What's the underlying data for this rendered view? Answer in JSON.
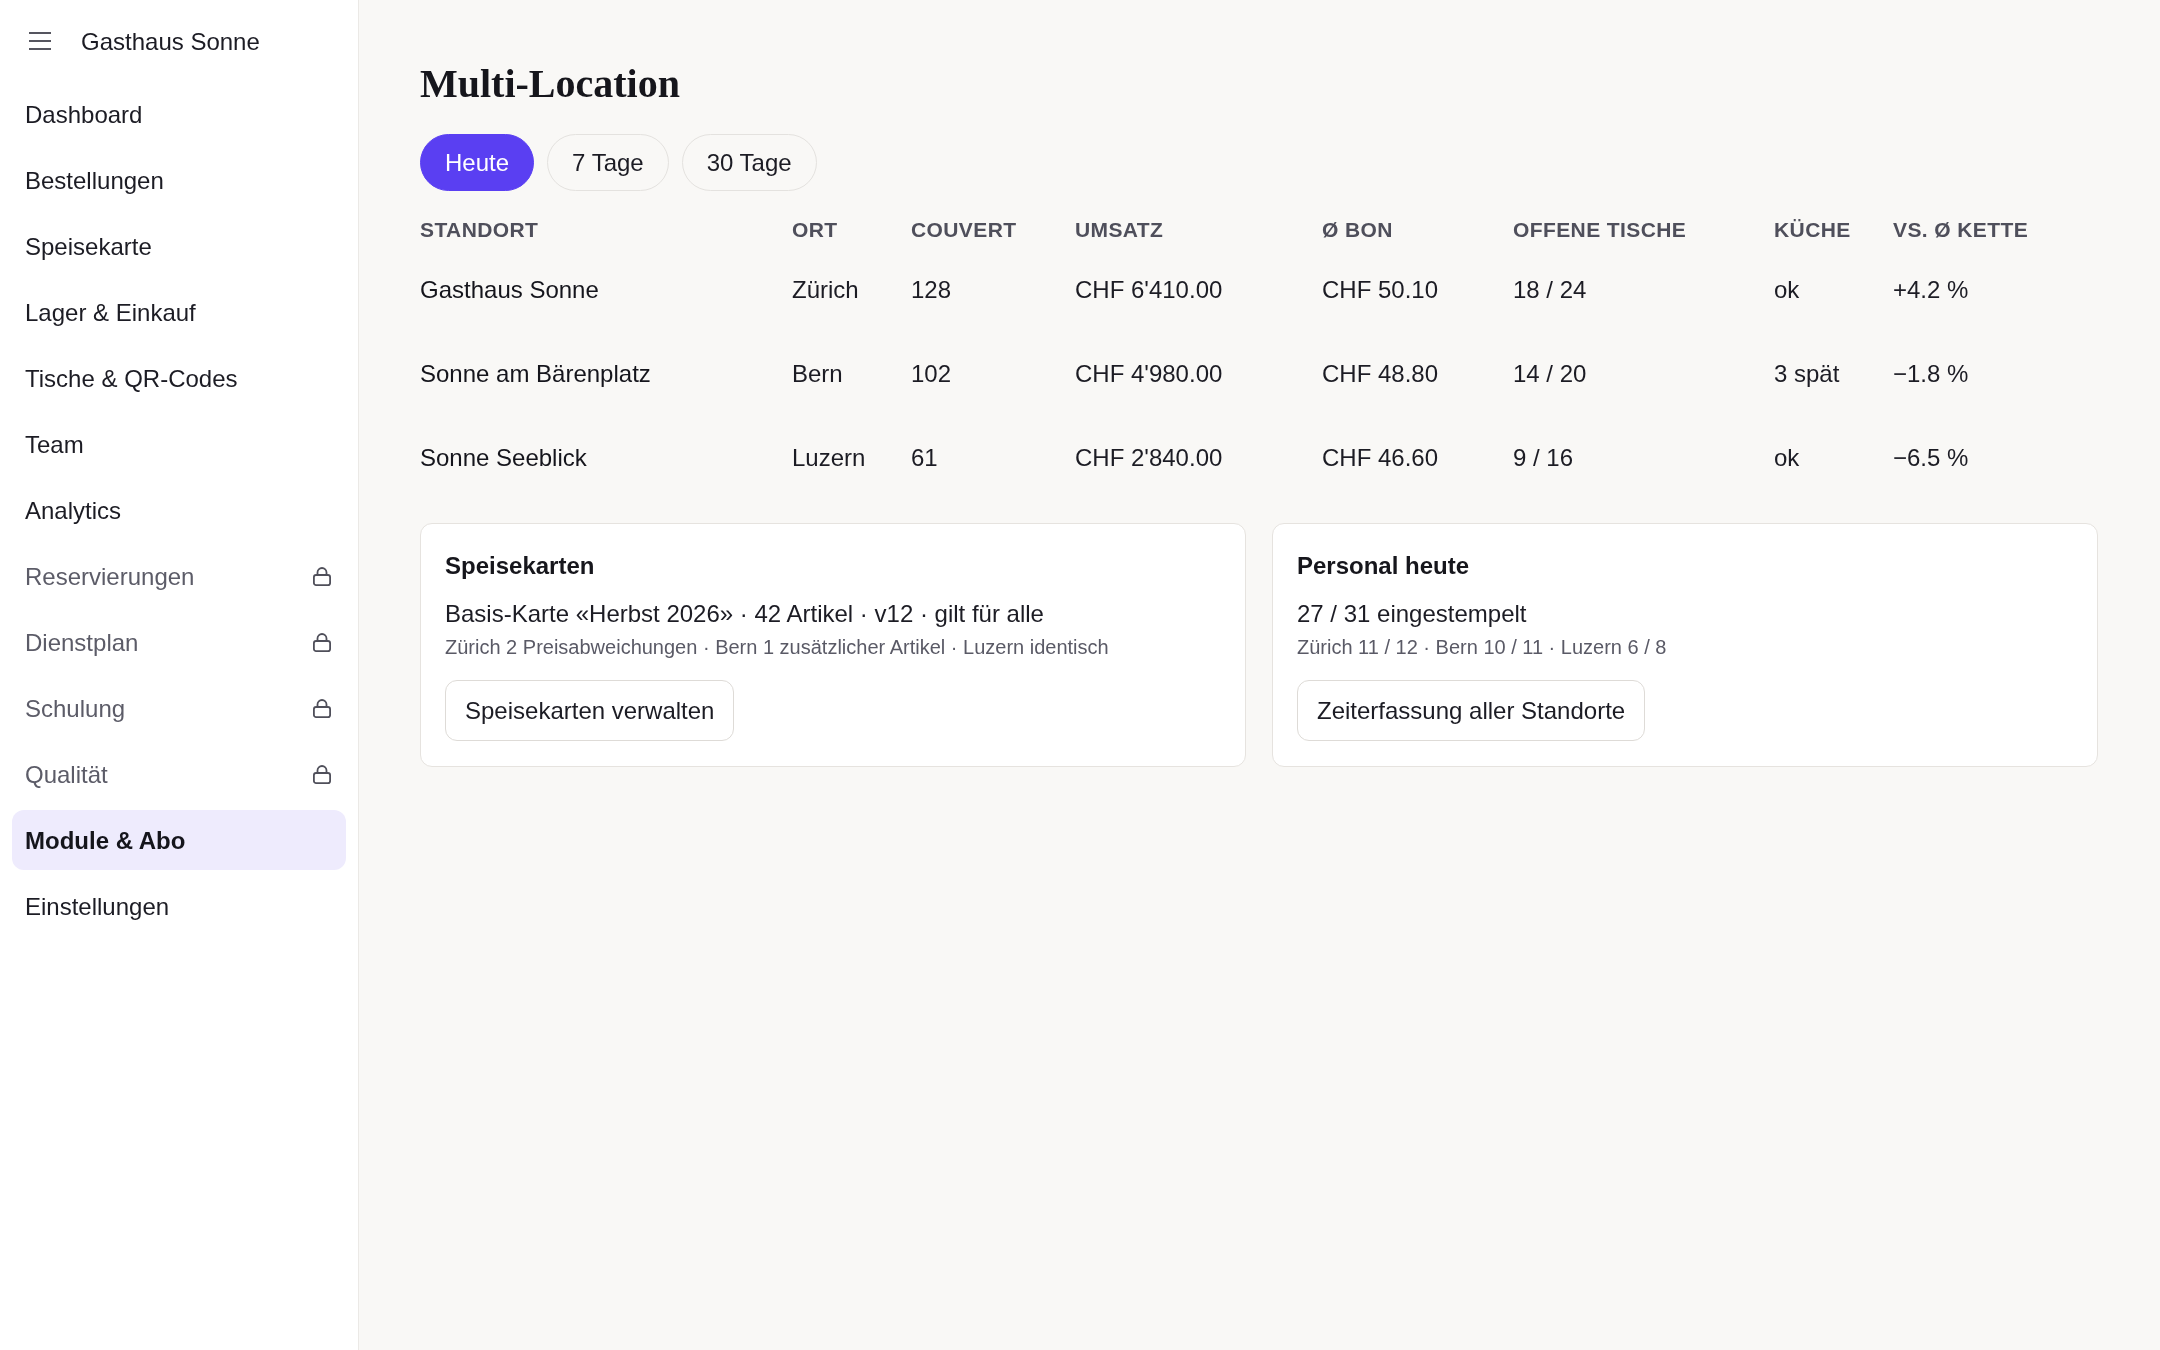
{
  "sidebar": {
    "brand": "Gasthaus Sonne",
    "items": [
      {
        "label": "Dashboard",
        "locked": false,
        "selected": false
      },
      {
        "label": "Bestellungen",
        "locked": false,
        "selected": false
      },
      {
        "label": "Speisekarte",
        "locked": false,
        "selected": false
      },
      {
        "label": "Lager & Einkauf",
        "locked": false,
        "selected": false
      },
      {
        "label": "Tische & QR-Codes",
        "locked": false,
        "selected": false
      },
      {
        "label": "Team",
        "locked": false,
        "selected": false
      },
      {
        "label": "Analytics",
        "locked": false,
        "selected": false
      },
      {
        "label": "Reservierungen",
        "locked": true,
        "selected": false
      },
      {
        "label": "Dienstplan",
        "locked": true,
        "selected": false
      },
      {
        "label": "Schulung",
        "locked": true,
        "selected": false
      },
      {
        "label": "Qualität",
        "locked": true,
        "selected": false
      },
      {
        "label": "Module & Abo",
        "locked": false,
        "selected": true
      },
      {
        "label": "Einstellungen",
        "locked": false,
        "selected": false
      }
    ]
  },
  "page": {
    "title": "Multi-Location",
    "periods": [
      {
        "label": "Heute",
        "selected": true
      },
      {
        "label": "7 Tage",
        "selected": false
      },
      {
        "label": "30 Tage",
        "selected": false
      }
    ]
  },
  "table": {
    "columns": [
      "STANDORT",
      "ORT",
      "COUVERT",
      "UMSATZ",
      "Ø BON",
      "OFFENE TISCHE",
      "KÜCHE",
      "VS. Ø KETTE"
    ],
    "rows": [
      [
        "Gasthaus Sonne",
        "Zürich",
        "128",
        "CHF 6'410.00",
        "CHF 50.10",
        "18 / 24",
        "ok",
        "+4.2 %"
      ],
      [
        "Sonne am Bärenplatz",
        "Bern",
        "102",
        "CHF 4'980.00",
        "CHF 48.80",
        "14 / 20",
        "3 spät",
        "−1.8 %"
      ],
      [
        "Sonne Seeblick",
        "Luzern",
        "61",
        "CHF 2'840.00",
        "CHF 46.60",
        "9 / 16",
        "ok",
        "−6.5 %"
      ]
    ]
  },
  "cards": [
    {
      "title": "Speisekarten",
      "summary": "Basis-Karte «Herbst 2026» · 42 Artikel · v12 · gilt für alle",
      "detail": "Zürich 2 Preisabweichungen · Bern 1 zusätzlicher Artikel · Luzern identisch",
      "button": "Speisekarten verwalten"
    },
    {
      "title": "Personal heute",
      "summary": "27 / 31 eingestempelt",
      "detail": "Zürich 11 / 12 · Bern 10 / 11 · Luzern 6 / 8",
      "button": "Zeiterfassung aller Standorte"
    }
  ]
}
